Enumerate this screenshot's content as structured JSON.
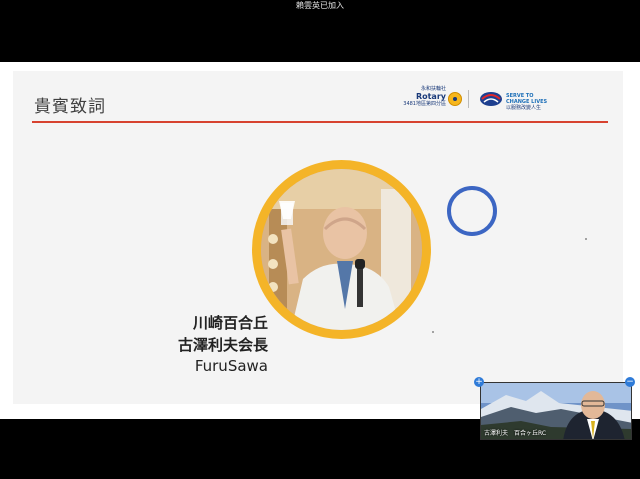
{
  "notification": {
    "text": "賴雲英已加入"
  },
  "slide": {
    "title": "貴賓致詞",
    "logo": {
      "club_line": "永和扶輪社",
      "rotary": "Rotary",
      "district_line": "3481地區第四分區",
      "theme_line1": "SERVE TO",
      "theme_line2": "CHANGE LIVES",
      "theme_line3": "以服務改變人生"
    },
    "speaker": {
      "club": "川崎百合丘",
      "name_title": "古澤利夫会長",
      "romaji": "FuruSawa"
    },
    "colors": {
      "accent_ring": "#f4b428",
      "accent_circle": "#3c66c3",
      "title_rule": "#d7422f"
    }
  },
  "video_tile": {
    "participant_label": "古澤利夫　百合ヶ丘RC",
    "add_button": "+",
    "remove_button": "−"
  }
}
